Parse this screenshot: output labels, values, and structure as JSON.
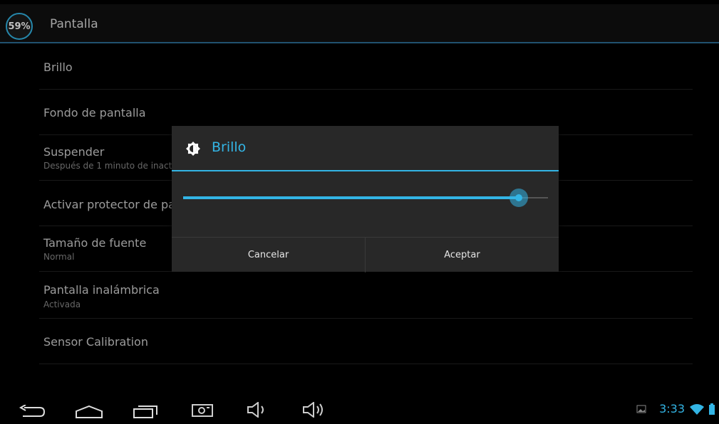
{
  "action_bar": {
    "badge": "59%",
    "title": "Pantalla"
  },
  "settings": [
    {
      "title": "Brillo",
      "subtitle": ""
    },
    {
      "title": "Fondo de pantalla",
      "subtitle": ""
    },
    {
      "title": "Suspender",
      "subtitle": "Después de 1 minuto de inact"
    },
    {
      "title": "Activar protector de par",
      "subtitle": ""
    },
    {
      "title": "Tamaño de fuente",
      "subtitle": "Normal"
    },
    {
      "title": "Pantalla inalámbrica",
      "subtitle": "Activada"
    },
    {
      "title": "Sensor Calibration",
      "subtitle": ""
    }
  ],
  "dialog": {
    "title": "Brillo",
    "brightness_fraction": 0.92,
    "cancel": "Cancelar",
    "accept": "Aceptar"
  },
  "status_bar": {
    "time": "3:33"
  },
  "colors": {
    "accent": "#33b5e5",
    "background": "#000000",
    "dialog": "#282828"
  }
}
